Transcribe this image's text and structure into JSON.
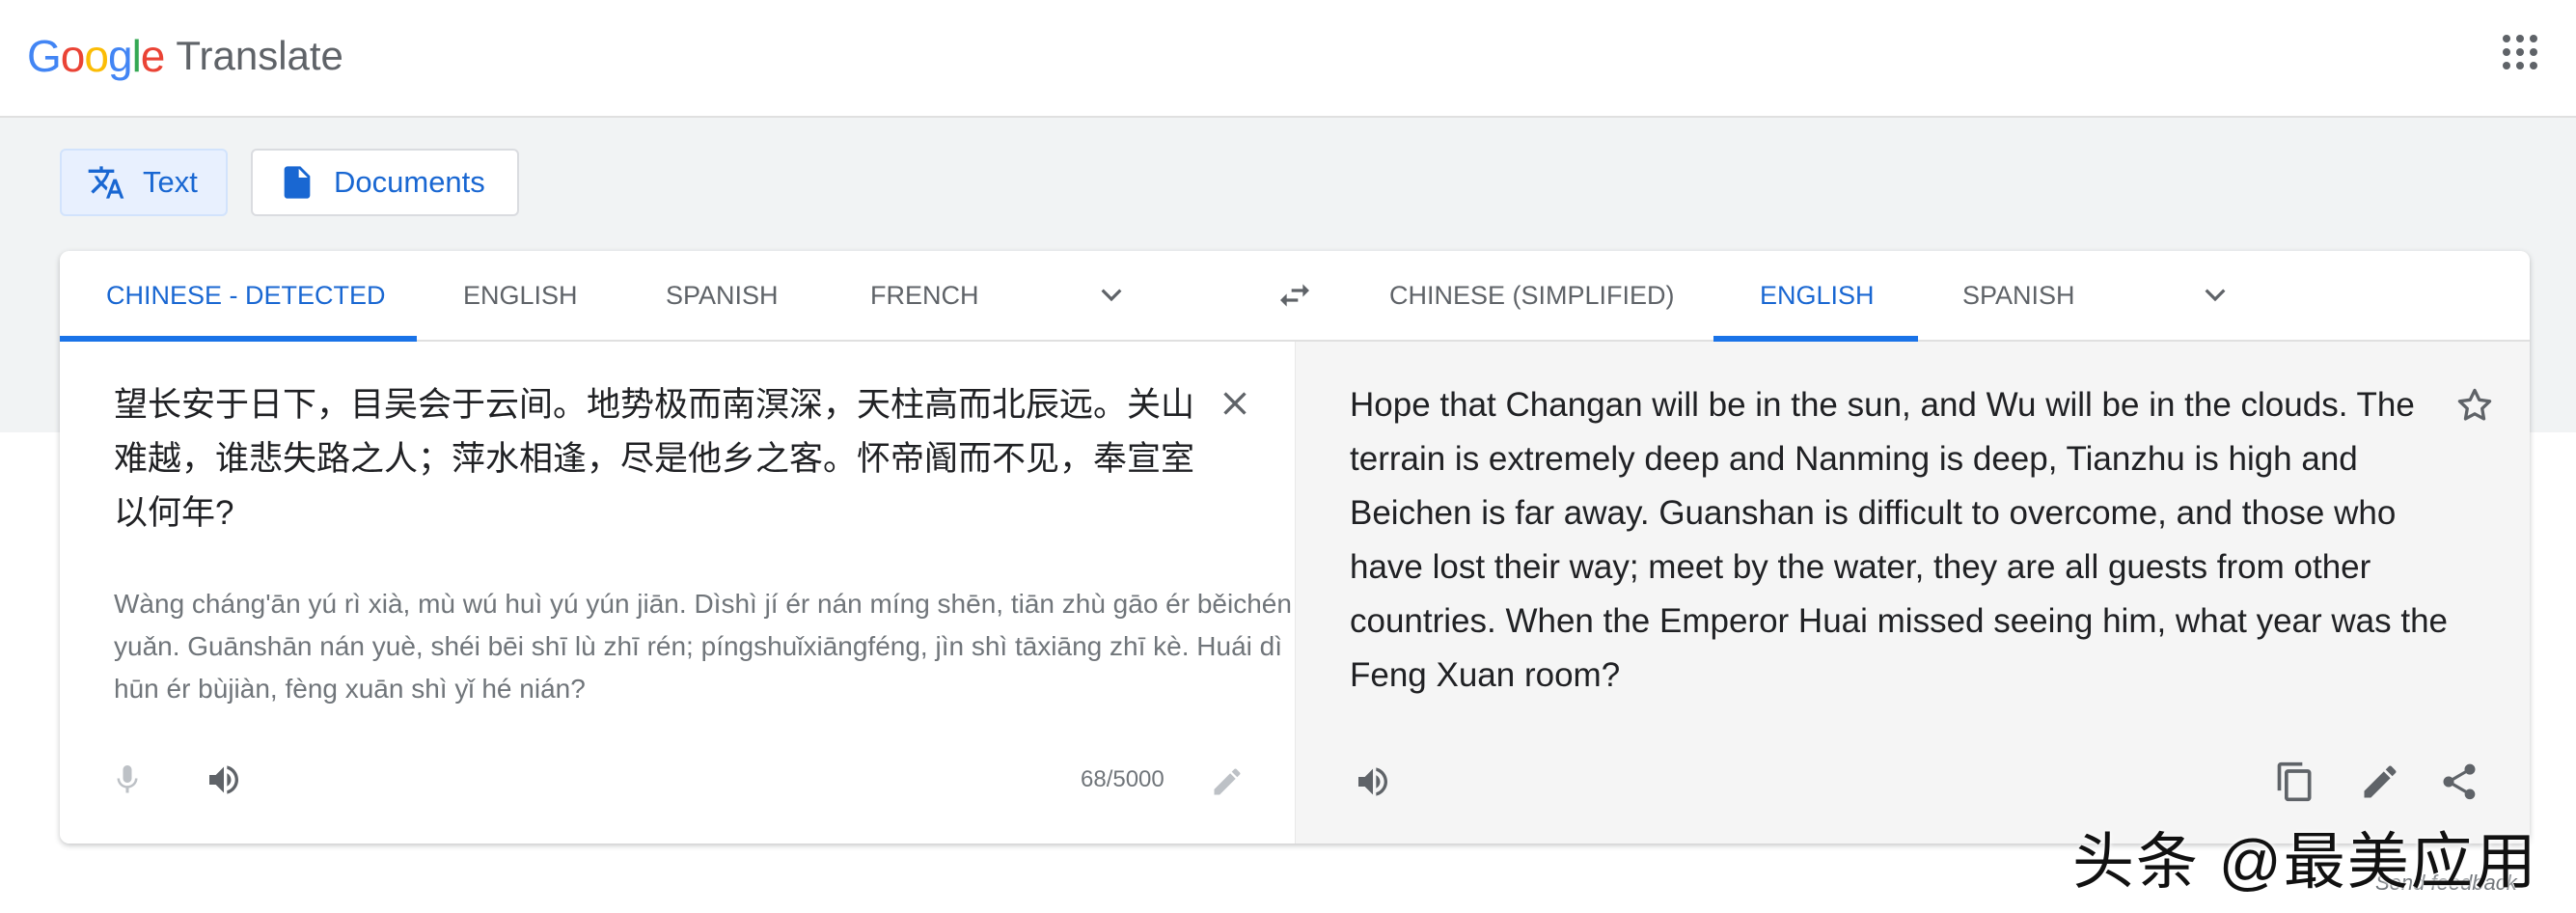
{
  "header": {
    "logo_letters": [
      {
        "char": "G",
        "color": "#4285F4"
      },
      {
        "char": "o",
        "color": "#EA4335"
      },
      {
        "char": "o",
        "color": "#FBBC05"
      },
      {
        "char": "g",
        "color": "#4285F4"
      },
      {
        "char": "l",
        "color": "#34A853"
      },
      {
        "char": "e",
        "color": "#EA4335"
      }
    ],
    "product": "Translate",
    "apps_icon": "apps-grid-icon"
  },
  "modes": {
    "text_label": "Text",
    "documents_label": "Documents"
  },
  "source_langs": [
    "CHINESE - DETECTED",
    "ENGLISH",
    "SPANISH",
    "FRENCH"
  ],
  "target_langs": [
    "CHINESE (SIMPLIFIED)",
    "ENGLISH",
    "SPANISH"
  ],
  "source": {
    "text": "望长安于日下，目吴会于云间。地势极而南溟深，天柱高而北辰远。关山难越，谁悲失路之人；萍水相逢，尽是他乡之客。怀帝阍而不见，奉宣室以何年?",
    "transliteration": "Wàng cháng'ān yú rì xià, mù wú huì yú yún jiān. Dìshì jí ér nán míng shēn, tiān zhù gāo ér běichén yuǎn. Guānshān nán yuè, shéi bēi shī lù zhī rén; píngshuǐxiāngféng, jìn shì tāxiāng zhī kè. Huái dì hūn ér bùjiàn, fèng xuān shì yǐ hé nián?",
    "char_count": "68/5000"
  },
  "target": {
    "text": "Hope that Changan will be in the sun, and Wu will be in the clouds. The terrain is extremely deep and Nanming is deep, Tianzhu is high and Beichen is far away. Guanshan is difficult to overcome, and those who have lost their way; meet by the water, they are all guests from other countries. When the Emperor Huai missed seeing him, what year was the Feng Xuan room?"
  },
  "watermark": "头条 @最美应用",
  "feedback": "Send feedback",
  "colors": {
    "accent": "#1a73e8",
    "active_text": "#1967d2"
  }
}
